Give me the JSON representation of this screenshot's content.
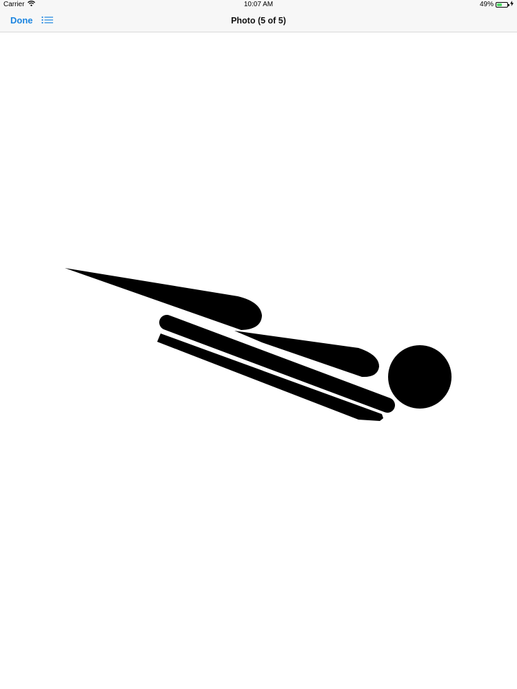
{
  "status_bar": {
    "carrier": "Carrier",
    "time": "10:07 AM",
    "battery_text": "49%",
    "battery_level": 0.49,
    "battery_color": "#4cd964"
  },
  "nav_bar": {
    "done_label": "Done",
    "list_icon": "list-icon",
    "title": "Photo (5 of 5)",
    "accent_color": "#1a84e0"
  },
  "photo": {
    "subject": "luge-pictogram",
    "fill_color": "#000000",
    "background_color": "#ffffff"
  }
}
